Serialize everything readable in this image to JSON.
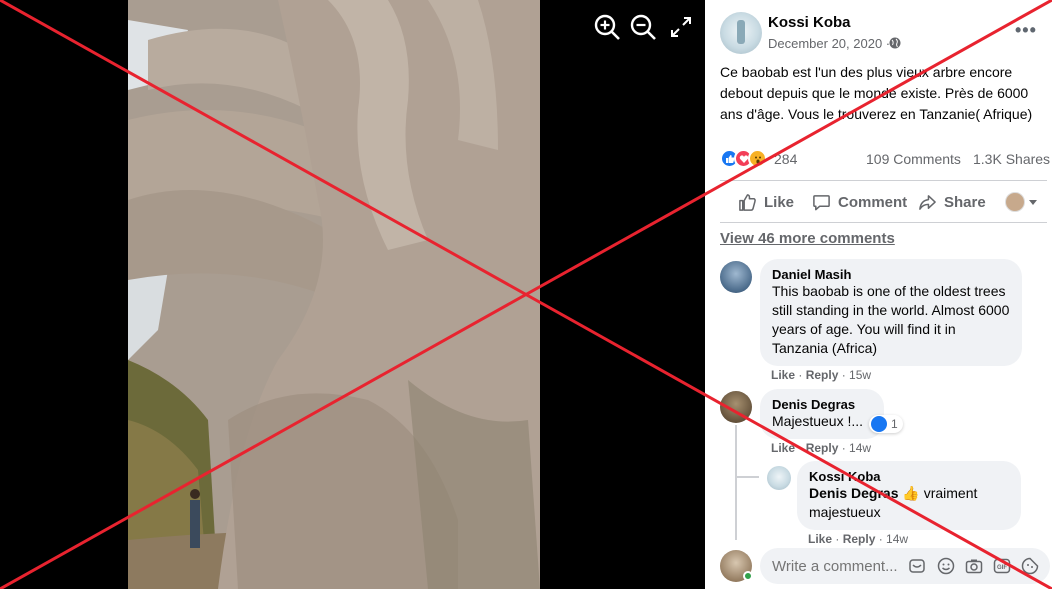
{
  "viewer": {
    "photo_description_icon": "photo-of-giant-baobab",
    "tools": [
      "zoom-in-icon",
      "zoom-out-icon",
      "fullscreen-icon"
    ]
  },
  "post": {
    "author": "Kossi Koba",
    "date": "December 20, 2020 ·",
    "privacy_icon": "globe-icon",
    "text": "Ce baobab est l'un des plus vieux arbre encore debout depuis que le monde existe. Près de 6000 ans d'âge. Vous le trouverez en Tanzanie( Afrique)",
    "reaction_count": "284",
    "comments_count": "109 Comments",
    "shares_count": "1.3K Shares",
    "actions": {
      "like": "Like",
      "comment": "Comment",
      "share": "Share"
    }
  },
  "comments": {
    "view_more": "View 46 more comments",
    "items": [
      {
        "name": "Daniel Masih",
        "text": "This baobab is one of the oldest trees still standing in the world. Almost 6000 years of age. You will find it in Tanzania (Africa)",
        "like": "Like",
        "reply": "Reply",
        "time": "15w"
      },
      {
        "name": "Denis Degras",
        "text": "Majestueux !...",
        "like": "Like",
        "reply": "Reply",
        "time": "14w",
        "reaction_count": "1"
      }
    ],
    "reply": {
      "name": "Kossi Koba",
      "mention": "Denis Degras",
      "text": "vraiment majestueux",
      "like": "Like",
      "reply": "Reply",
      "time": "14w"
    },
    "composer_placeholder": "Write a comment...",
    "composer_icons": [
      "sticker-icon",
      "emoji-icon",
      "camera-icon",
      "gif-icon",
      "sticker-face-icon"
    ]
  },
  "colors": {
    "overlay_cross": "#e8232f",
    "link_blue": "#1877f2",
    "secondary_text": "#65676b"
  }
}
